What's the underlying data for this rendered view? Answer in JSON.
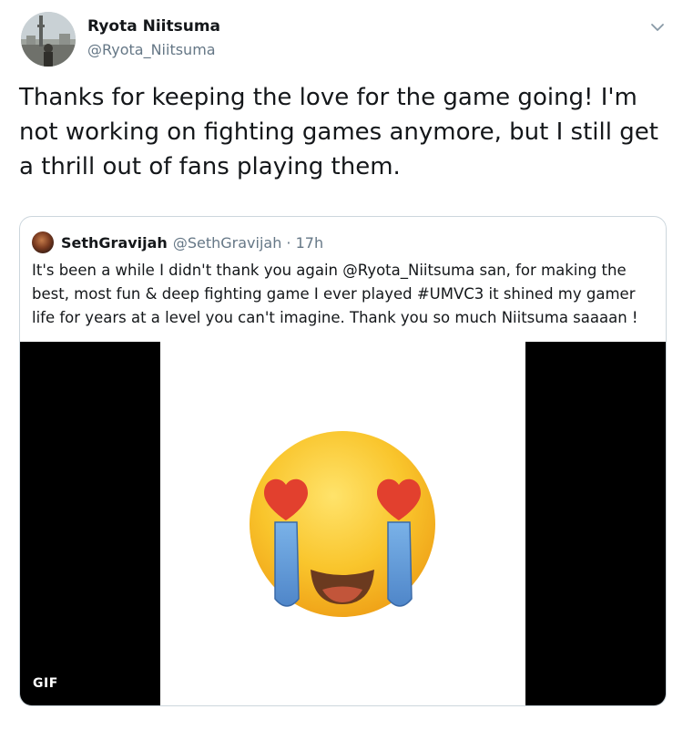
{
  "author": {
    "display_name": "Ryota Niitsuma",
    "handle": "@Ryota_Niitsuma"
  },
  "tweet": {
    "text": "Thanks for keeping the love for the game going! I'm not working on fighting games anymore, but I still get a thrill out of fans playing them."
  },
  "quoted_tweet": {
    "display_name": "SethGravijah",
    "meta": "@SethGravijah · 17h",
    "text": "It's been a while I didn't thank you again @Ryota_Niitsuma san, for making the best, most fun & deep fighting game I ever played #UMVC3 it shined my gamer life for years at a level you can't imagine. Thank you so much Niitsuma saaaan !",
    "media": {
      "type": "gif",
      "badge": "GIF",
      "depicts": "heart-eyes-crying-emoji"
    }
  },
  "icons": {
    "more_menu": "chevron-down-icon"
  },
  "colors": {
    "text_primary": "#14171a",
    "text_secondary": "#657786",
    "border": "#ccd6dd",
    "media_background": "#000000"
  }
}
